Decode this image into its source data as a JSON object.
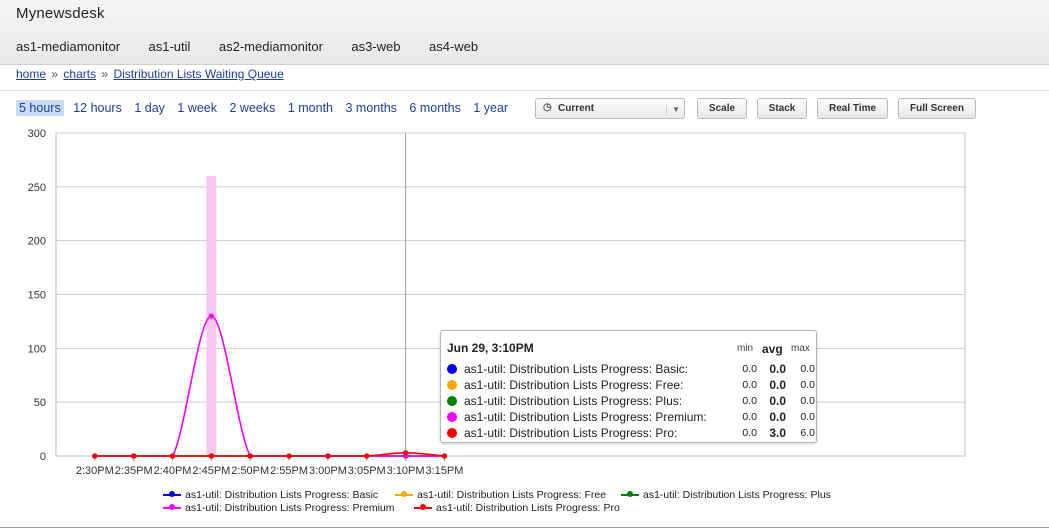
{
  "app": {
    "title": "Mynewsdesk"
  },
  "host_tabs": [
    "as1-mediamonitor",
    "as1-util",
    "as2-mediamonitor",
    "as3-web",
    "as4-web"
  ],
  "breadcrumb": {
    "home": "home",
    "charts": "charts",
    "separator": "»",
    "current": "Distribution Lists Waiting Queue"
  },
  "ranges": {
    "items": [
      "5 hours",
      "12 hours",
      "1 day",
      "1 week",
      "2 weeks",
      "1 month",
      "3 months",
      "6 months",
      "1 year"
    ],
    "active": "5 hours"
  },
  "controls": {
    "select_value": "Current",
    "scale": "Scale",
    "stack": "Stack",
    "realtime": "Real Time",
    "fullscreen": "Full Screen"
  },
  "colors": {
    "basic": "#0000ff",
    "free": "#ffa500",
    "plus": "#008000",
    "premium": "#ff00ff",
    "pro": "#ff0000",
    "link": "#1a3fa8",
    "active_range_bg": "#c9dbf5"
  },
  "tooltip": {
    "title": "Jun 29, 3:10PM",
    "headers": {
      "min": "min",
      "avg": "avg",
      "max": "max"
    },
    "rows": [
      {
        "label": "as1-util: Distribution Lists Progress: Basic:",
        "color": "#0000ff",
        "min": "0.0",
        "avg": "0.0",
        "max": "0.0"
      },
      {
        "label": "as1-util: Distribution Lists Progress: Free:",
        "color": "#ffa500",
        "min": "0.0",
        "avg": "0.0",
        "max": "0.0"
      },
      {
        "label": "as1-util: Distribution Lists Progress: Plus:",
        "color": "#008000",
        "min": "0.0",
        "avg": "0.0",
        "max": "0.0"
      },
      {
        "label": "as1-util: Distribution Lists Progress: Premium:",
        "color": "#ff00ff",
        "min": "0.0",
        "avg": "0.0",
        "max": "0.0"
      },
      {
        "label": "as1-util: Distribution Lists Progress: Pro:",
        "color": "#ff0000",
        "min": "0.0",
        "avg": "3.0",
        "max": "6.0"
      }
    ]
  },
  "chart_data": {
    "type": "line",
    "title": "",
    "xlabel": "",
    "ylabel": "",
    "ylim": [
      0,
      300
    ],
    "yticks": [
      0,
      50,
      100,
      150,
      200,
      250,
      300
    ],
    "xlim_minutes": [
      865,
      982
    ],
    "xticks": [
      {
        "label": "2:30PM",
        "t": 870
      },
      {
        "label": "2:35PM",
        "t": 875
      },
      {
        "label": "2:40PM",
        "t": 880
      },
      {
        "label": "2:45PM",
        "t": 885
      },
      {
        "label": "2:50PM",
        "t": 890
      },
      {
        "label": "2:55PM",
        "t": 895
      },
      {
        "label": "3:00PM",
        "t": 900
      },
      {
        "label": "3:05PM",
        "t": 905
      },
      {
        "label": "3:10PM",
        "t": 910
      },
      {
        "label": "3:15PM",
        "t": 915
      }
    ],
    "grid": true,
    "legend_position": "bottom",
    "series": [
      {
        "name": "as1-util: Distribution Lists Progress: Basic",
        "color": "#0000ff",
        "points": [
          [
            870,
            0
          ],
          [
            875,
            0
          ],
          [
            880,
            0
          ],
          [
            885,
            0
          ],
          [
            890,
            0
          ],
          [
            895,
            0
          ],
          [
            900,
            0
          ],
          [
            905,
            0
          ],
          [
            910,
            0
          ],
          [
            915,
            0
          ]
        ]
      },
      {
        "name": "as1-util: Distribution Lists Progress: Free",
        "color": "#ffa500",
        "points": [
          [
            870,
            0
          ],
          [
            875,
            0
          ],
          [
            880,
            0
          ],
          [
            885,
            0
          ],
          [
            890,
            0
          ],
          [
            895,
            0
          ],
          [
            900,
            0
          ],
          [
            905,
            0
          ],
          [
            910,
            0
          ],
          [
            915,
            0
          ]
        ]
      },
      {
        "name": "as1-util: Distribution Lists Progress: Plus",
        "color": "#008000",
        "points": [
          [
            870,
            0
          ],
          [
            875,
            0
          ],
          [
            880,
            0
          ],
          [
            885,
            0
          ],
          [
            890,
            0
          ],
          [
            895,
            0
          ],
          [
            900,
            0
          ],
          [
            905,
            0
          ],
          [
            910,
            0
          ],
          [
            915,
            0
          ]
        ]
      },
      {
        "name": "as1-util: Distribution Lists Progress: Premium",
        "color": "#ff00ff",
        "points": [
          [
            870,
            0
          ],
          [
            875,
            0
          ],
          [
            880,
            0
          ],
          [
            885,
            130
          ],
          [
            890,
            0
          ],
          [
            895,
            0
          ],
          [
            900,
            0
          ],
          [
            905,
            0
          ],
          [
            910,
            0
          ],
          [
            915,
            0
          ]
        ]
      },
      {
        "name": "as1-util: Distribution Lists Progress: Pro",
        "color": "#ff0000",
        "points": [
          [
            870,
            0
          ],
          [
            875,
            0
          ],
          [
            880,
            0
          ],
          [
            885,
            0
          ],
          [
            890,
            0
          ],
          [
            895,
            0
          ],
          [
            900,
            0
          ],
          [
            905,
            0
          ],
          [
            910,
            3
          ],
          [
            915,
            0
          ]
        ]
      }
    ],
    "highlight_bar": {
      "t": 885,
      "value": 260,
      "color": "#f7c6ef"
    },
    "crosshair_t": 910
  }
}
